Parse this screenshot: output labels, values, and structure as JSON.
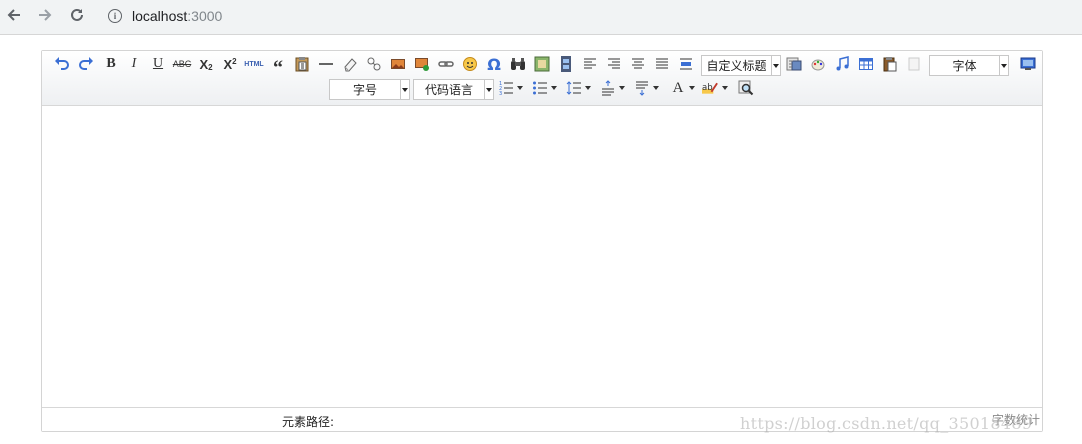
{
  "browser": {
    "url_host": "localhost",
    "url_port": ":3000",
    "icons": [
      "back-arrow-icon",
      "forward-arrow-icon",
      "reload-icon",
      "site-info-icon"
    ]
  },
  "editor": {
    "toolbar": {
      "bold_label": "B",
      "italic_label": "I",
      "underline_label": "U",
      "strike_label": "ABC",
      "subscript_label": "X",
      "subscript_small": "2",
      "superscript_label": "X",
      "superscript_small": "2",
      "html_label": "HTML",
      "quote_label": "“",
      "omega_label": "Ω",
      "paragraph_select": "自定义标题",
      "font_family_select": "字体",
      "font_size_select": "字号",
      "code_language_select": "代码语言",
      "font_color_label": "A"
    },
    "statusbar": {
      "element_path_label": "元素路径:",
      "word_count_label": "字数统计"
    }
  },
  "watermark": "https://blog.csdn.net/qq_35018489",
  "colors": {
    "undo_blue": "#3b6fd4",
    "toolbar_top": "#ffffff",
    "toolbar_bottom": "#eef0f2",
    "border": "#d4d4d4"
  }
}
